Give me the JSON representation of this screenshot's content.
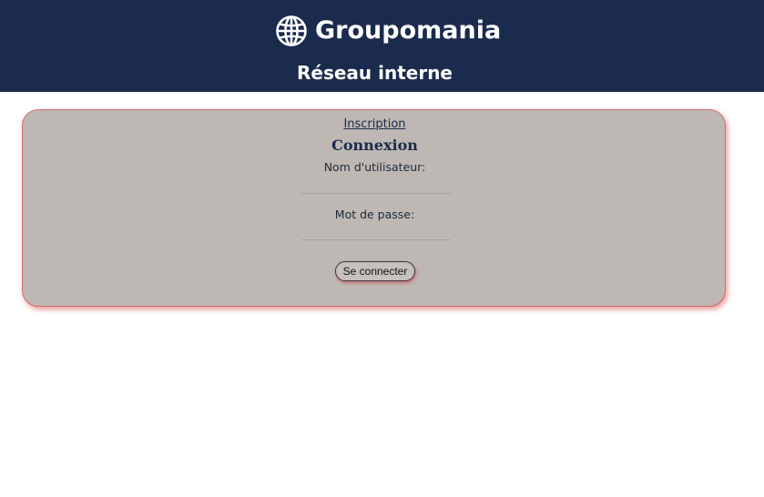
{
  "header": {
    "brand_name": "Groupomania",
    "brand_icon": "globe-icon",
    "subtitle": "Réseau interne",
    "background_color": "#1b2b4d"
  },
  "card": {
    "signup_link": "Inscription",
    "title": "Connexion",
    "username_label": "Nom d'utilisateur:",
    "username_value": "",
    "password_label": "Mot de passe:",
    "password_value": "",
    "submit_label": "Se connecter",
    "background_color": "#bdb8b3",
    "accent_color": "#d86b6b"
  }
}
